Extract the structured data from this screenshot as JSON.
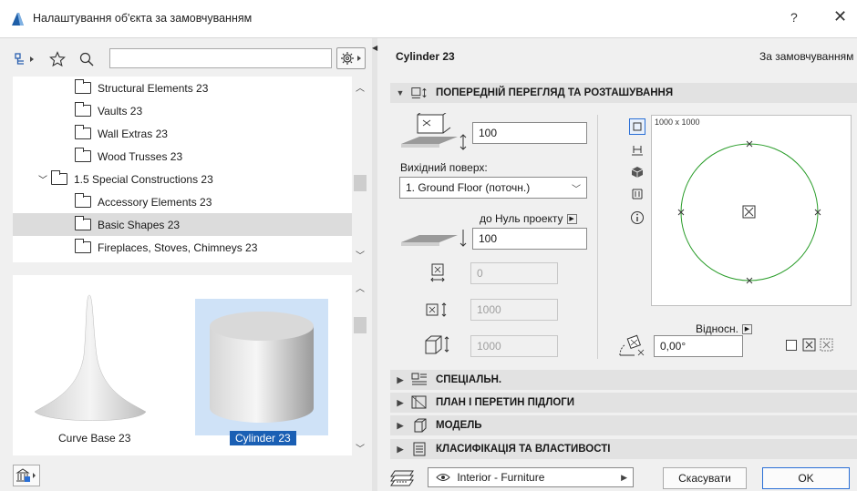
{
  "window": {
    "title": "Налаштування об'єкта за замовчуванням",
    "help_label": "?",
    "close_label": "✕"
  },
  "library": {
    "search": {
      "value": "",
      "placeholder": ""
    },
    "tree": [
      {
        "label": "Structural Elements 23",
        "level": 2,
        "expanded": null,
        "selected": false
      },
      {
        "label": "Vaults 23",
        "level": 2,
        "expanded": null,
        "selected": false
      },
      {
        "label": "Wall Extras 23",
        "level": 2,
        "expanded": null,
        "selected": false
      },
      {
        "label": "Wood Trusses 23",
        "level": 2,
        "expanded": null,
        "selected": false
      },
      {
        "label": "1.5 Special Constructions 23",
        "level": 1,
        "expanded": true,
        "selected": false
      },
      {
        "label": "Accessory Elements 23",
        "level": 2,
        "expanded": null,
        "selected": false
      },
      {
        "label": "Basic Shapes 23",
        "level": 2,
        "expanded": null,
        "selected": true
      },
      {
        "label": "Fireplaces, Stoves, Chimneys 23",
        "level": 2,
        "expanded": null,
        "selected": false
      }
    ],
    "thumbnails": [
      {
        "label": "Curve Base 23",
        "selected": false
      },
      {
        "label": "Cylinder 23",
        "selected": true
      }
    ]
  },
  "object": {
    "name": "Cylinder 23",
    "mode": "За замовчуванням"
  },
  "sections": {
    "preview": "ПОПЕРЕДНІЙ ПЕРЕГЛЯД ТА РОЗТАШУВАННЯ",
    "special": "СПЕЦІАЛЬН.",
    "floorplan": "ПЛАН І ПЕРЕТИН ПІДЛОГИ",
    "model": "МОДЕЛЬ",
    "classification": "КЛАСИФІКАЦІЯ ТА ВЛАСТИВОСТІ"
  },
  "placement": {
    "elevation_value": "100",
    "home_story_label": "Вихідний поверх:",
    "home_story_value": "1. Ground Floor (поточн.)",
    "reference_label": "до Нуль проекту",
    "reference_value": "100",
    "width_value": "0",
    "depth_value": "1000",
    "height_value": "1000",
    "preview_size_label": "1000 x 1000",
    "relative_label": "Відносн.",
    "angle_value": "0,00°"
  },
  "footer": {
    "layer_value": "Interior - Furniture",
    "cancel_label": "Скасувати",
    "ok_label": "OK"
  },
  "colors": {
    "selection": "#1a5fb4",
    "preview_circle": "#2a9d2a",
    "tree_selected": "#dcdcdc"
  }
}
